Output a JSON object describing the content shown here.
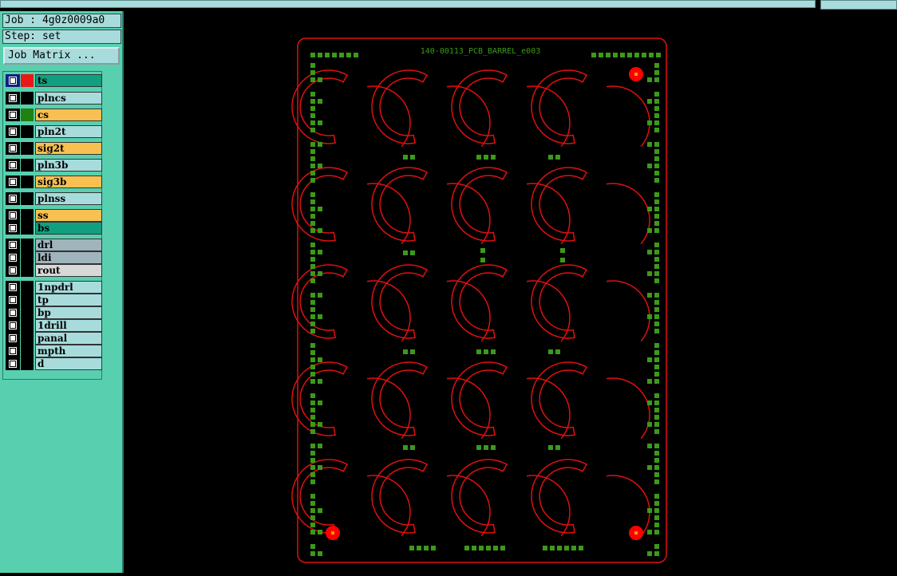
{
  "topbar": {},
  "sidebar": {
    "job_label": "Job : 4g0z0009a0",
    "step_label": "Step: set",
    "job_matrix_button": "Job Matrix ..."
  },
  "layers": [
    {
      "name": "ts",
      "bg": "#10a080",
      "swatch": "#e81818",
      "active": true
    },
    {
      "name": "plncs",
      "bg": "#a8dcdc",
      "swatch": "#000000",
      "active": false
    },
    {
      "name": "cs",
      "bg": "#f8c050",
      "swatch": "#208010",
      "active": false
    },
    {
      "name": "pln2t",
      "bg": "#a8dcdc",
      "swatch": "#000000",
      "active": false
    },
    {
      "name": "sig2t",
      "bg": "#f8c050",
      "swatch": "#000000",
      "active": false
    },
    {
      "name": "pln3b",
      "bg": "#a8dcdc",
      "swatch": "#000000",
      "active": false
    },
    {
      "name": "sig3b",
      "bg": "#f8c050",
      "swatch": "#000000",
      "active": false
    },
    {
      "name": "plnss",
      "bg": "#a8dcdc",
      "swatch": "#000000",
      "active": false
    },
    {
      "name": "ss",
      "bg": "#f8c050",
      "swatch": "#000000",
      "active": false
    },
    {
      "name": "bs",
      "bg": "#10a080",
      "swatch": "#000000",
      "active": false
    },
    {
      "name": "drl",
      "bg": "#a0b4bc",
      "swatch": "#000000",
      "active": false
    },
    {
      "name": "ldi",
      "bg": "#a0b4bc",
      "swatch": "#000000",
      "active": false
    },
    {
      "name": "rout",
      "bg": "#d8d8d8",
      "swatch": "#000000",
      "active": false
    },
    {
      "name": "1npdrl",
      "bg": "#a8dcdc",
      "swatch": "#000000",
      "active": false
    },
    {
      "name": "tp",
      "bg": "#a8dcdc",
      "swatch": "#000000",
      "active": false
    },
    {
      "name": "bp",
      "bg": "#a8dcdc",
      "swatch": "#000000",
      "active": false
    },
    {
      "name": "1drill",
      "bg": "#a8dcdc",
      "swatch": "#000000",
      "active": false
    },
    {
      "name": "panal",
      "bg": "#a8dcdc",
      "swatch": "#000000",
      "active": false
    },
    {
      "name": "mpth",
      "bg": "#a8dcdc",
      "swatch": "#000000",
      "active": false
    },
    {
      "name": "d",
      "bg": "#a8dcdc",
      "swatch": "#000000",
      "active": false
    }
  ],
  "board": {
    "title": "140-00113_PCB_BARREL_e003",
    "outline_color": "#e01010",
    "pad_color": "#3c9a18",
    "fiducial_color": "#ff0000",
    "grid_rows": 5,
    "grid_cols": 4
  }
}
